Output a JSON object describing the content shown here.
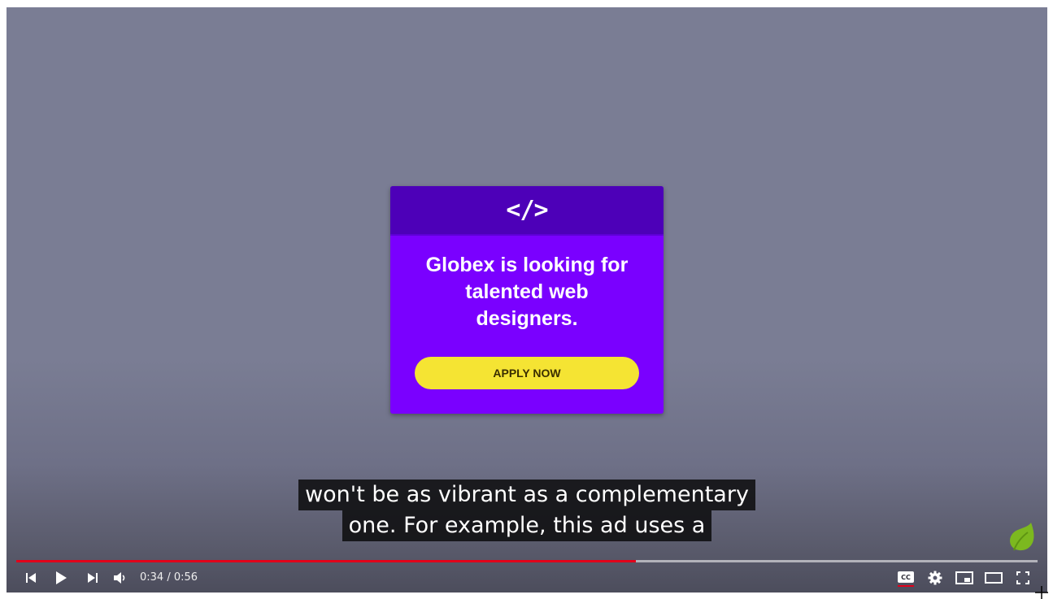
{
  "ad": {
    "code_symbol": "</>",
    "headline": "Globex is looking for talented web designers.",
    "button_label": "APPLY NOW"
  },
  "captions": {
    "line1": "won't be as vibrant as a complementary",
    "line2": "one. For example, this ad uses a"
  },
  "player": {
    "current_time": "0:34",
    "separator": " / ",
    "duration": "0:56",
    "progress_fraction": 0.607,
    "cc_label": "CC"
  },
  "icons": [
    "previous-icon",
    "play-icon",
    "next-icon",
    "volume-icon",
    "cc-icon",
    "settings-icon",
    "miniplayer-icon",
    "theater-icon",
    "fullscreen-icon",
    "leaf-watermark-icon"
  ],
  "colors": {
    "ad_background": "#7a00ff",
    "ad_header": "#4d00b8",
    "button": "#f5e433",
    "progress_played": "#e1001a"
  }
}
